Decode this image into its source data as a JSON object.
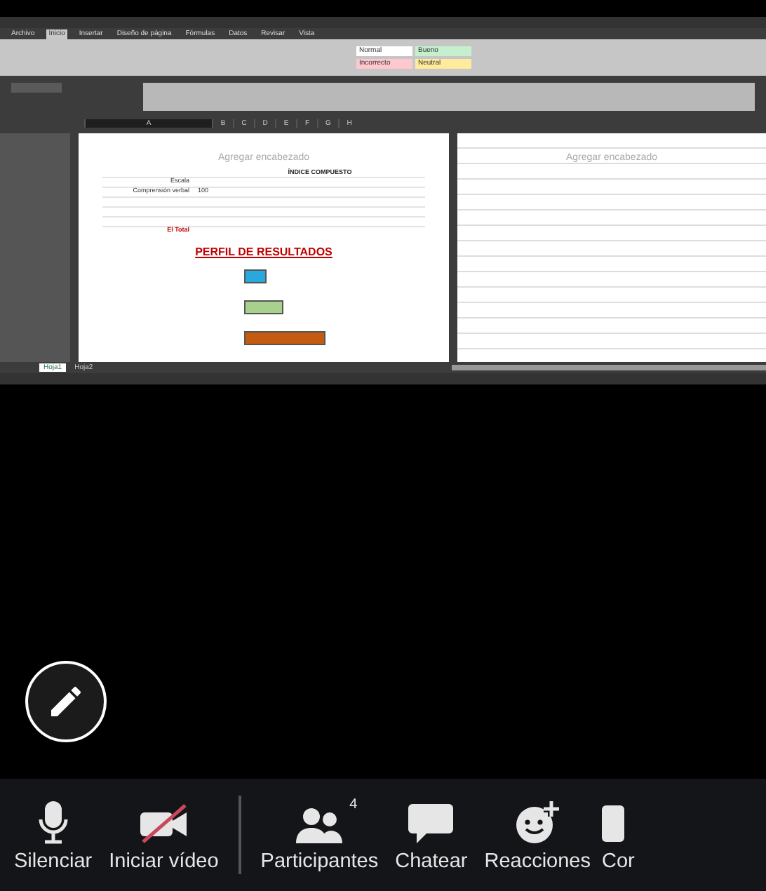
{
  "shared_screen": {
    "ribbon_tabs": [
      {
        "label": "Archivo",
        "selected": false
      },
      {
        "label": "Inicio",
        "selected": true
      },
      {
        "label": "Insertar",
        "selected": false
      },
      {
        "label": "Diseño de página",
        "selected": false
      },
      {
        "label": "Fórmulas",
        "selected": false
      },
      {
        "label": "Datos",
        "selected": false
      },
      {
        "label": "Revisar",
        "selected": false
      },
      {
        "label": "Vista",
        "selected": false
      }
    ],
    "styles": [
      {
        "label": "Normal",
        "color": "#ffffff"
      },
      {
        "label": "Bueno",
        "color": "#c6efce"
      },
      {
        "label": "Incorrecto",
        "color": "#ffc7ce"
      },
      {
        "label": "Neutral",
        "color": "#ffeb9c"
      }
    ],
    "columns": [
      "A",
      "B",
      "C",
      "D",
      "E",
      "F",
      "G",
      "H"
    ],
    "pages": [
      {
        "header": "Agregar encabezado",
        "title": "ÍNDICE COMPUESTO",
        "rows": [
          {
            "label": "Escala",
            "value": ""
          },
          {
            "label": "Comprensión verbal",
            "value": "100"
          },
          {
            "label": "",
            "value": ""
          },
          {
            "label": "",
            "value": ""
          },
          {
            "label": "",
            "value": ""
          },
          {
            "label": "El Total",
            "value": ""
          }
        ],
        "profile_title": "PERFIL DE RESULTADOS",
        "bars": [
          {
            "color": "#29a8e0"
          },
          {
            "color": "#a9d18e"
          },
          {
            "color": "#c55a11"
          }
        ]
      },
      {
        "header": "Agregar encabezado"
      }
    ],
    "sheet_tabs": [
      {
        "label": "Hoja1",
        "selected": true
      },
      {
        "label": "Hoja2",
        "selected": false
      }
    ]
  },
  "toolbar": [
    {
      "kind": "mic",
      "label": "Silenciar"
    },
    {
      "kind": "video-off",
      "label": "Iniciar vídeo"
    },
    {
      "kind": "divider"
    },
    {
      "kind": "participants",
      "label": "Participantes",
      "badge": "4"
    },
    {
      "kind": "chat",
      "label": "Chatear"
    },
    {
      "kind": "reactions",
      "label": "Reacciones"
    },
    {
      "kind": "more",
      "label": "Cor"
    }
  ]
}
